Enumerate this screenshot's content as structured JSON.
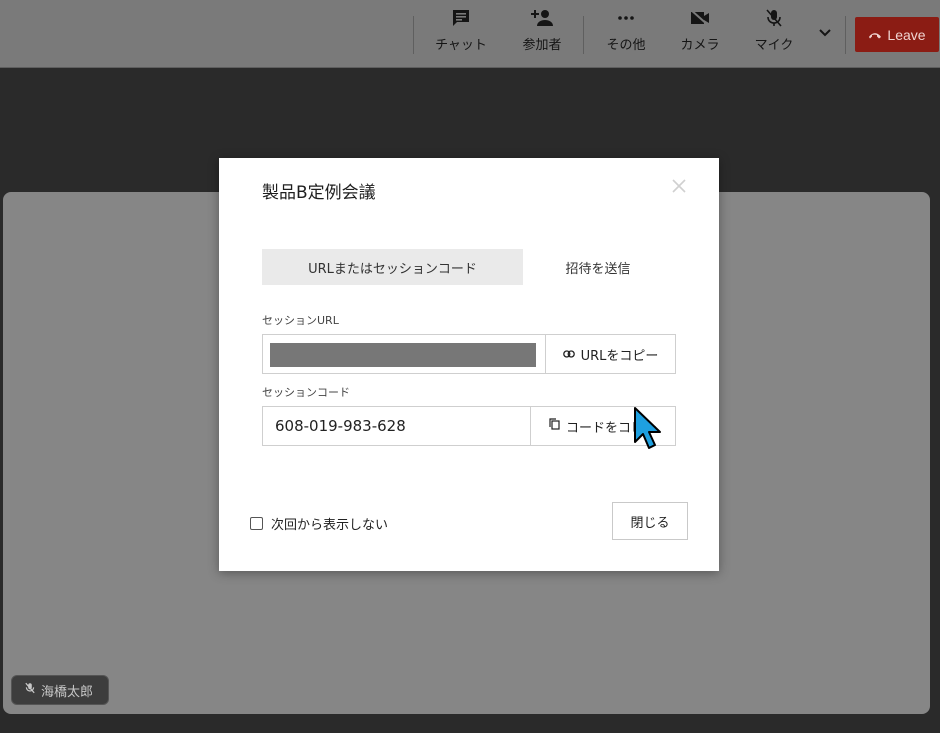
{
  "toolbar": {
    "chat_label": "チャット",
    "participants_label": "参加者",
    "more_label": "その他",
    "camera_label": "カメラ",
    "mic_label": "マイク",
    "leave_label": "Leave"
  },
  "dialog": {
    "title": "製品B定例会議",
    "tabs": [
      "URLまたはセッションコード",
      "招待を送信"
    ],
    "session_url_label": "セッションURL",
    "copy_url_label": "URLをコピー",
    "session_code_label": "セッションコード",
    "session_code_value": "608-019-983-628",
    "copy_code_label": "コードをコピー",
    "dont_show_label": "次回から表示しない",
    "close_label": "閉じる"
  },
  "participant": {
    "name": "海橋太郎"
  },
  "colors": {
    "leave_bg": "#8b1c14",
    "stage_bg": "#868686",
    "cursor": "#1ea0e0"
  }
}
